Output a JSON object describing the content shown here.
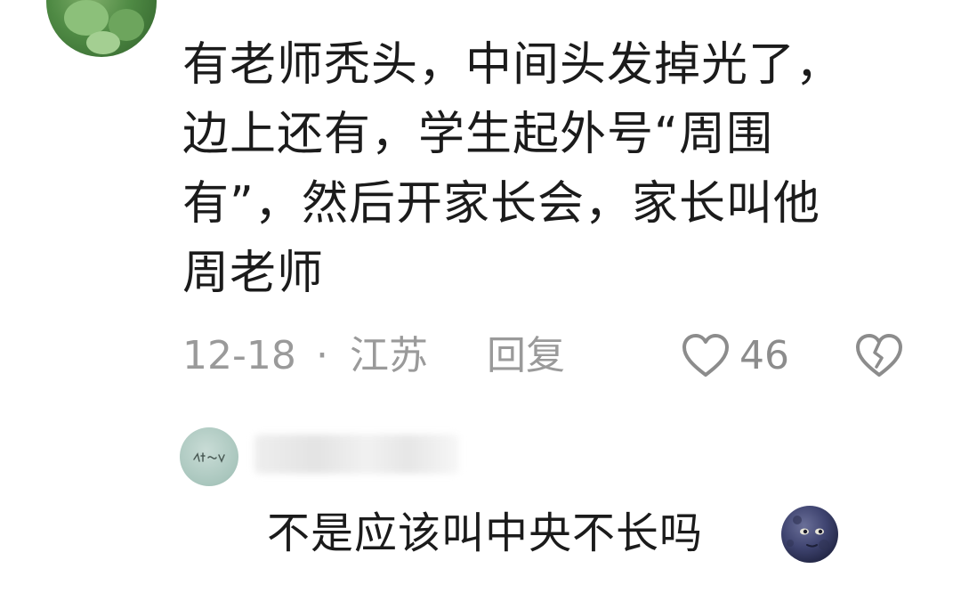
{
  "comment": {
    "lines": [
      "有老师秃头，中间头发掉光了，",
      "边上还有，学生起外号“周围",
      "有”，然后开家长会，家长叫他",
      "周老师"
    ],
    "date": "12-18",
    "separator": "·",
    "location": "江苏",
    "reply_label": "回复",
    "like_count": "46",
    "like_icon": "heart-outline-icon",
    "dislike_icon": "broken-heart-icon"
  },
  "reply": {
    "text": "不是应该叫中央不长吗",
    "emoji": "moon-face-emoji"
  },
  "colors": {
    "text": "#1b1b1b",
    "meta": "#9a9a9a",
    "icon": "#8c8c8c"
  }
}
